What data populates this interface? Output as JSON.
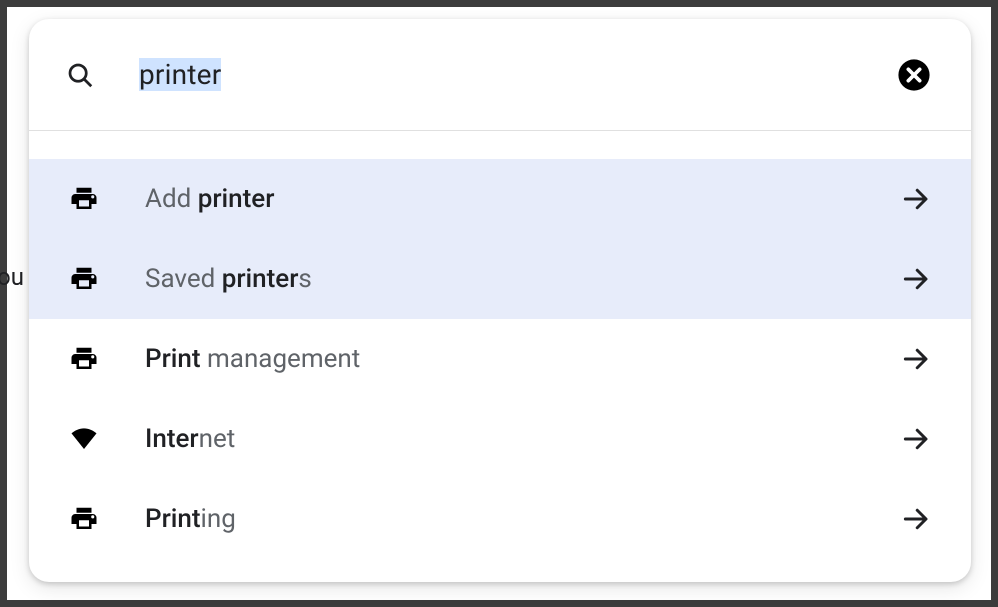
{
  "search": {
    "query": "printer",
    "selected": true
  },
  "background_hint": "ou",
  "results": [
    {
      "icon": "print",
      "highlighted": true,
      "segments": [
        {
          "text": "Add ",
          "bold": false
        },
        {
          "text": "printer",
          "bold": true
        }
      ]
    },
    {
      "icon": "print",
      "highlighted": true,
      "segments": [
        {
          "text": "Saved ",
          "bold": false
        },
        {
          "text": "printer",
          "bold": true
        },
        {
          "text": "s",
          "bold": false
        }
      ]
    },
    {
      "icon": "print",
      "highlighted": false,
      "segments": [
        {
          "text": "Print",
          "bold": true
        },
        {
          "text": " management",
          "bold": false
        }
      ]
    },
    {
      "icon": "wifi",
      "highlighted": false,
      "segments": [
        {
          "text": "Inter",
          "bold": true
        },
        {
          "text": "net",
          "bold": false
        }
      ]
    },
    {
      "icon": "print",
      "highlighted": false,
      "segments": [
        {
          "text": "Print",
          "bold": true
        },
        {
          "text": "ing",
          "bold": false
        }
      ]
    }
  ]
}
